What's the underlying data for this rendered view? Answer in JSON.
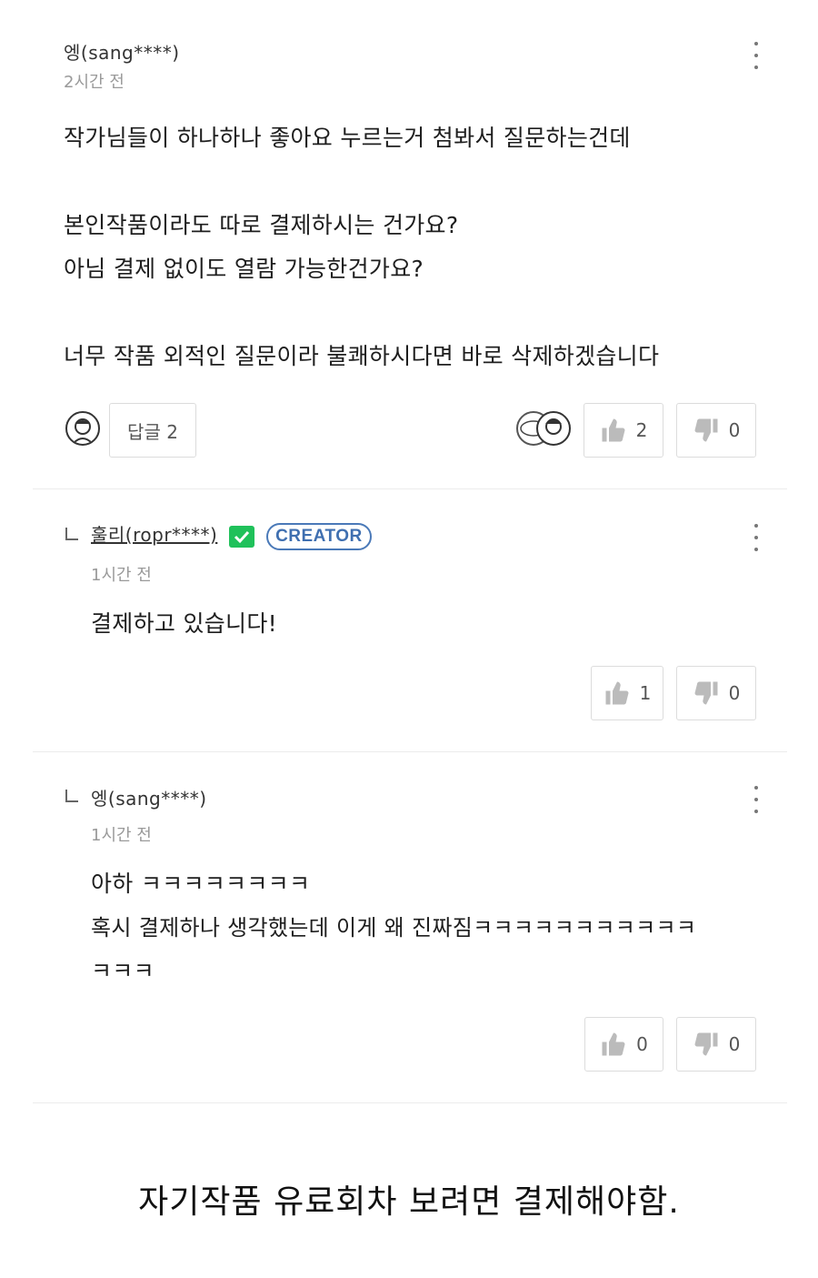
{
  "comments": [
    {
      "author": "엥(sang****)",
      "time": "2시간 전",
      "lines": [
        "작가님들이 하나하나 좋아요 누르는거 첨봐서 질문하는건데",
        "",
        "본인작품이라도 따로 결제하시는 건가요?",
        "아님 결제 없이도 열람 가능한건가요?",
        "",
        "너무 작품 외적인 질문이라 불쾌하시다면 바로 삭제하겠습니다"
      ],
      "reply_button": "답글 2",
      "likes": "2",
      "dislikes": "0"
    },
    {
      "author": "훌리(ropr****)",
      "creator_badge": "CREATOR",
      "time": "1시간 전",
      "lines": [
        "결제하고 있습니다!"
      ],
      "likes": "1",
      "dislikes": "0"
    },
    {
      "author": "엥(sang****)",
      "time": "1시간 전",
      "lines": [
        "아하 ㅋㅋㅋㅋㅋㅋㅋㅋ",
        "혹시 결제하나 생각했는데 이게 왜 진짜짐ㅋㅋㅋㅋㅋㅋㅋㅋㅋㅋㅋ",
        "ㅋㅋㅋ"
      ],
      "likes": "0",
      "dislikes": "0"
    }
  ],
  "caption": "자기작품 유료회차 보려면 결제해야함.",
  "colors": {
    "creator_check": "#1fc15a",
    "creator_badge": "#3f6fb0",
    "divider": "#ececec"
  },
  "icons": [
    "more-vertical-icon",
    "thumbs-up-icon",
    "thumbs-down-icon",
    "reply-indent-icon",
    "check-icon"
  ]
}
